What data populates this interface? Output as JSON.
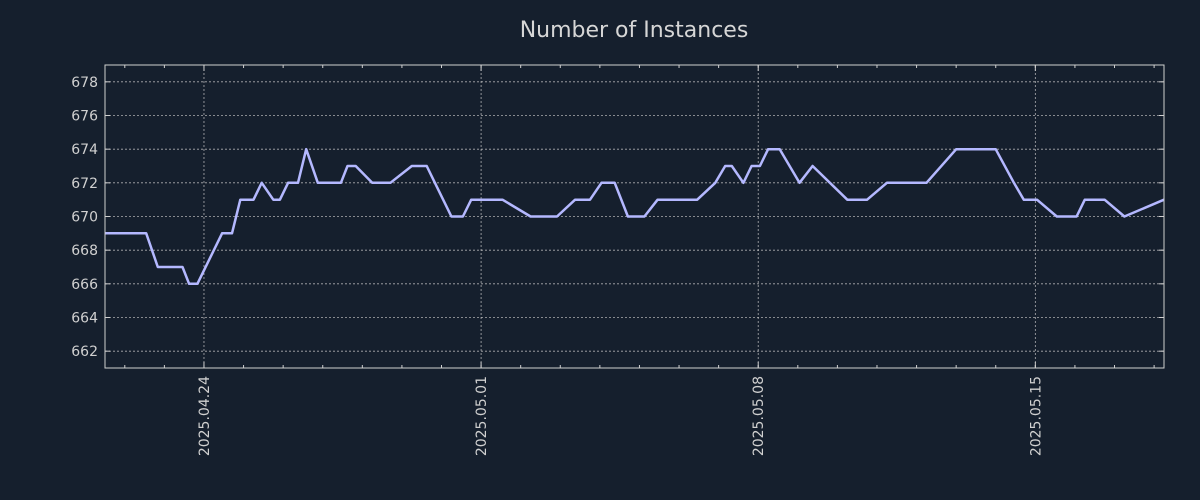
{
  "chart_data": {
    "type": "line",
    "title": "Number of Instances",
    "xlabel": "",
    "ylabel": "",
    "x_range": [
      "2025-04-21 12:00",
      "2025-05-18 06:00"
    ],
    "ylim": [
      661,
      679
    ],
    "y_ticks": [
      662,
      664,
      666,
      668,
      670,
      672,
      674,
      676,
      678
    ],
    "x_ticks": [
      {
        "date": "2025-04-24",
        "label": "2025.04.24"
      },
      {
        "date": "2025-05-01",
        "label": "2025.05.01"
      },
      {
        "date": "2025-05-08",
        "label": "2025.05.08"
      },
      {
        "date": "2025-05-15",
        "label": "2025.05.15"
      }
    ],
    "grid": true,
    "colors": {
      "background": "#151f2d",
      "line": "#b4b8ff"
    },
    "series": [
      {
        "x": [
          "2025-04-21 12:00",
          "2025-04-22 13:00",
          "2025-04-22 20:00",
          "2025-04-23 11:00",
          "2025-04-23 15:00",
          "2025-04-23 20:00",
          "2025-04-24 11:00",
          "2025-04-24 17:00",
          "2025-04-24 22:00",
          "2025-04-25 06:00",
          "2025-04-25 11:00",
          "2025-04-25 18:00",
          "2025-04-25 22:00",
          "2025-04-26 03:00",
          "2025-04-26 09:00",
          "2025-04-26 14:00",
          "2025-04-26 21:00",
          "2025-04-27 06:00",
          "2025-04-27 11:00",
          "2025-04-27 15:00",
          "2025-04-27 20:00",
          "2025-04-28 06:00",
          "2025-04-28 17:00",
          "2025-04-29 06:00",
          "2025-04-29 15:00",
          "2025-04-29 20:00",
          "2025-04-30 06:00",
          "2025-04-30 13:00",
          "2025-04-30 18:00",
          "2025-04-30 22:00",
          "2025-05-01 06:00",
          "2025-05-01 13:00",
          "2025-05-02 06:00",
          "2025-05-02 22:00",
          "2025-05-03 09:00",
          "2025-05-03 18:00",
          "2025-05-04 01:00",
          "2025-05-04 09:00",
          "2025-05-04 17:00",
          "2025-05-05 03:00",
          "2025-05-05 11:00",
          "2025-05-06 06:00",
          "2025-05-06 11:00",
          "2025-05-06 22:00",
          "2025-05-07 04:00",
          "2025-05-07 08:00",
          "2025-05-07 15:00",
          "2025-05-07 20:00",
          "2025-05-08 01:00",
          "2025-05-08 06:00",
          "2025-05-08 13:00",
          "2025-05-09 01:00",
          "2025-05-09 09:00",
          "2025-05-10 06:00",
          "2025-05-10 18:00",
          "2025-05-11 06:00",
          "2025-05-11 22:00",
          "2025-05-12 06:00",
          "2025-05-13 00:00",
          "2025-05-13 08:00",
          "2025-05-14 00:00",
          "2025-05-14 11:00",
          "2025-05-14 17:00",
          "2025-05-15 01:00",
          "2025-05-15 13:00",
          "2025-05-16 01:00",
          "2025-05-16 06:00",
          "2025-05-16 18:00",
          "2025-05-17 06:00",
          "2025-05-18 06:00"
        ],
        "y": [
          669,
          669,
          667,
          667,
          666,
          666,
          669,
          669,
          671,
          671,
          672,
          671,
          671,
          672,
          672,
          674,
          672,
          672,
          672,
          673,
          673,
          672,
          672,
          673,
          673,
          672,
          670,
          670,
          671,
          671,
          671,
          671,
          670,
          670,
          671,
          671,
          672,
          672,
          670,
          670,
          671,
          671,
          671,
          672,
          673,
          673,
          672,
          673,
          673,
          674,
          674,
          672,
          673,
          671,
          671,
          672,
          672,
          672,
          674,
          674,
          674,
          672,
          671,
          671,
          670,
          670,
          671,
          671,
          670,
          671
        ]
      }
    ]
  }
}
